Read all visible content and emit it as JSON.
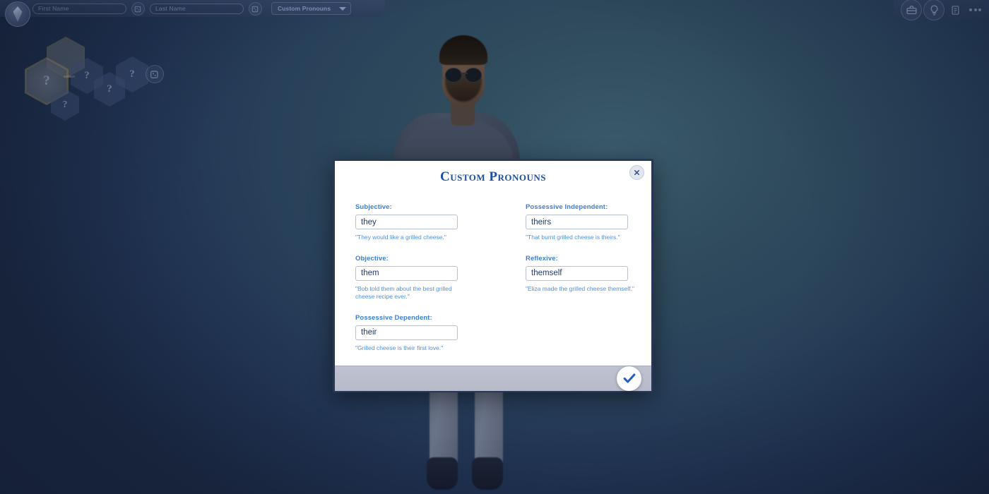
{
  "topbar": {
    "logo_icon": "plumbob-icon",
    "first_name_placeholder": "First Name",
    "last_name_placeholder": "Last Name",
    "randomize_icon": "dice-icon",
    "pronoun_dropdown_label": "Custom Pronouns",
    "dropdown_caret_icon": "chevron-down-icon"
  },
  "topright": {
    "gallery_icon": "briefcase-icon",
    "hints_icon": "lightbulb-icon",
    "notes_icon": "clipboard-icon",
    "more_icon": "more-dots-icon"
  },
  "traits": {
    "slots": [
      "?",
      "?",
      "?",
      "?",
      "?"
    ],
    "randomize_icon": "dice-icon"
  },
  "dialog": {
    "title": "Custom Pronouns",
    "close_icon": "close-icon",
    "confirm_icon": "checkmark-icon",
    "fields": [
      {
        "label": "Subjective:",
        "value": "they",
        "example": "\"They would like a grilled cheese.\"",
        "name": "subjective"
      },
      {
        "label": "Possessive Independent:",
        "value": "theirs",
        "example": "\"That burnt grilled cheese is theirs.\"",
        "name": "possessive-independent"
      },
      {
        "label": "Objective:",
        "value": "them",
        "example": "\"Bob told them about the best grilled cheese recipe ever.\"",
        "name": "objective"
      },
      {
        "label": "Reflexive:",
        "value": "themself",
        "example": "\"Eliza made the grilled cheese themself.\"",
        "name": "reflexive"
      },
      {
        "label": "Possessive Dependent:",
        "value": "their",
        "example": "\"Grilled cheese is their first love.\"",
        "name": "possessive-dependent"
      }
    ]
  },
  "colors": {
    "accent_blue": "#1f4fa0",
    "label_blue": "#3d7fd6",
    "example_blue": "#4f90e0",
    "input_text": "#243a66",
    "dialog_border": "#2a3655",
    "footer_bg": "#b6bac9"
  }
}
